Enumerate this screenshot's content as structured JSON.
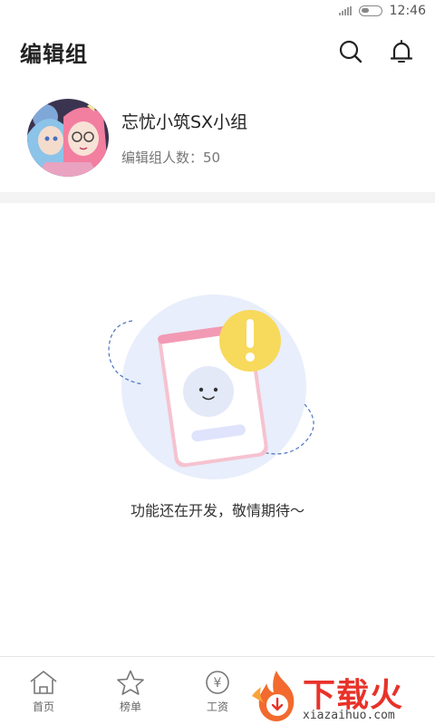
{
  "status_bar": {
    "time": "12:46"
  },
  "header": {
    "title": "编辑组"
  },
  "group": {
    "name": "忘忧小筑SX小组",
    "member_count_label": "编辑组人数：",
    "member_count": "50"
  },
  "empty_state": {
    "message": "功能还在开发，敬情期待～"
  },
  "tabs": [
    {
      "label": "首页",
      "icon": "home-icon"
    },
    {
      "label": "榜单",
      "icon": "star-icon"
    },
    {
      "label": "工资",
      "icon": "yen-icon"
    }
  ],
  "watermark": {
    "title": "下载火",
    "subtitle": "xiazaihuo.com"
  },
  "colors": {
    "brand_red": "#e8322a",
    "illustration_blue": "#e8eefb",
    "warning_yellow": "#f7d95c"
  }
}
